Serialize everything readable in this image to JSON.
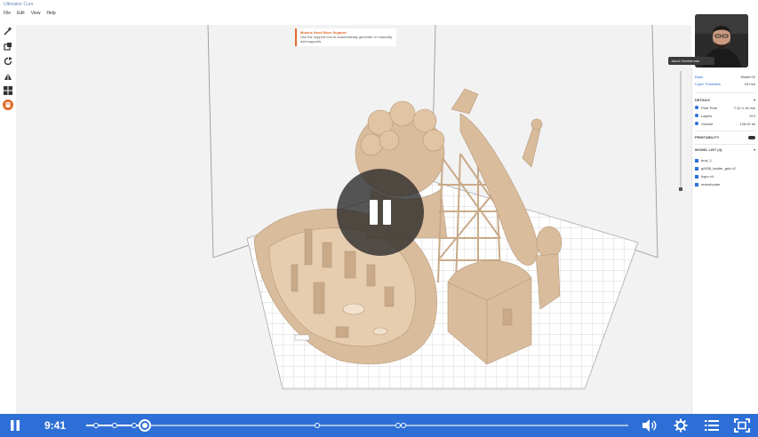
{
  "window": {
    "title": "Ultimaker Cura",
    "menu": [
      "File",
      "Edit",
      "View",
      "Help"
    ]
  },
  "viewport": {
    "support_message": {
      "title": "Models Need More Support",
      "body": "Use the support tool to automatically generate or manually add supports."
    }
  },
  "right_panel": {
    "setting1_label": "Base",
    "setting1_value": "Model 02",
    "setting2_label": "Layer Thickness",
    "setting2_value": ".15 mm",
    "details_heading": "DETAILS",
    "details": [
      {
        "label": "Print Time",
        "value": "7:12 h 16 min"
      },
      {
        "label": "Layers",
        "value": "374"
      },
      {
        "label": "Volume",
        "value": "126.02 ml"
      }
    ],
    "printability_label": "PRINTABILITY",
    "model_list_heading": "MODEL LIST (4)",
    "models": [
      "bust_1",
      "g0035_ladder_grid v2",
      "hypo v4",
      "motorhunter"
    ]
  },
  "presenter": {
    "name": "Jakob Dekkerman"
  },
  "player": {
    "time": "9:41",
    "progress_fraction": 0.108,
    "chapter_markers_fraction": [
      0.017,
      0.053,
      0.088,
      0.426,
      0.576,
      0.586
    ]
  },
  "colors": {
    "player_bar": "#2d6fd6",
    "model": "#d9bc9c",
    "accent": "#2a6fd6",
    "warning": "#e06a2a"
  },
  "icons": [
    "pause-icon",
    "volume-icon",
    "settings-icon",
    "chapters-icon",
    "fullscreen-icon"
  ]
}
